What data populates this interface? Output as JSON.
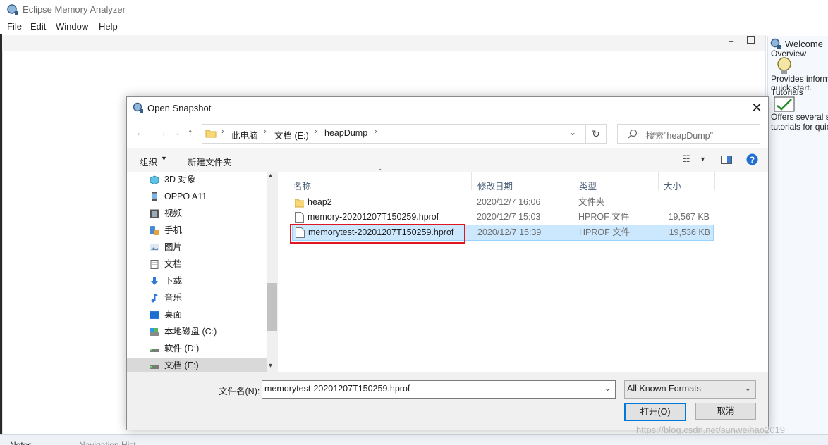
{
  "app": {
    "title": "Eclipse Memory Analyzer",
    "menu": [
      "File",
      "Edit",
      "Window",
      "Help"
    ]
  },
  "welcome": {
    "tab": "Welcome",
    "overview_title": "Overview",
    "overview_desc": "Provides inform",
    "overview_desc2": "quick start.",
    "tutorials_title": "Tutorials",
    "tutorials_desc": "Offers several s",
    "tutorials_desc2": "tutorials for quic"
  },
  "bottom_tabs": [
    "Notes",
    "Navigation Hist"
  ],
  "dialog": {
    "title": "Open Snapshot",
    "breadcrumb": [
      "此电脑",
      "文档 (E:)",
      "heapDump"
    ],
    "search_placeholder": "搜索\"heapDump\"",
    "organize_label": "组织",
    "new_folder_label": "新建文件夹",
    "nav_items": [
      {
        "label": "3D 对象",
        "icon": "3d-objects-icon"
      },
      {
        "label": "OPPO A11",
        "icon": "phone-device-icon"
      },
      {
        "label": "视频",
        "icon": "video-icon"
      },
      {
        "label": "手机",
        "icon": "phone-icon"
      },
      {
        "label": "图片",
        "icon": "pictures-icon"
      },
      {
        "label": "文档",
        "icon": "documents-icon"
      },
      {
        "label": "下载",
        "icon": "download-icon"
      },
      {
        "label": "音乐",
        "icon": "music-icon"
      },
      {
        "label": "桌面",
        "icon": "desktop-icon"
      },
      {
        "label": "本地磁盘 (C:)",
        "icon": "drive-icon"
      },
      {
        "label": "软件 (D:)",
        "icon": "drive-icon"
      },
      {
        "label": "文档 (E:)",
        "icon": "drive-icon",
        "selected": true
      }
    ],
    "columns": [
      "名称",
      "修改日期",
      "类型",
      "大小"
    ],
    "files": [
      {
        "name": "heap2",
        "date": "2020/12/7 16:06",
        "type": "文件夹",
        "size": "",
        "icon": "folder-icon"
      },
      {
        "name": "memory-20201207T150259.hprof",
        "date": "2020/12/7 15:03",
        "type": "HPROF 文件",
        "size": "19,567 KB",
        "icon": "file-icon"
      },
      {
        "name": "memorytest-20201207T150259.hprof",
        "date": "2020/12/7 15:39",
        "type": "HPROF 文件",
        "size": "19,536 KB",
        "icon": "file-icon",
        "selected": true
      }
    ],
    "filename_label": "文件名(N):",
    "filename_value": "memorytest-20201207T150259.hprof",
    "format_value": "All Known Formats",
    "open_label": "打开(O)",
    "cancel_label": "取消"
  },
  "watermark": "https://blog.csdn.net/sunweihao2019",
  "colors": {
    "selection": "#cce8ff",
    "highlight_box": "#e0151f",
    "accent": "#0078d7"
  }
}
